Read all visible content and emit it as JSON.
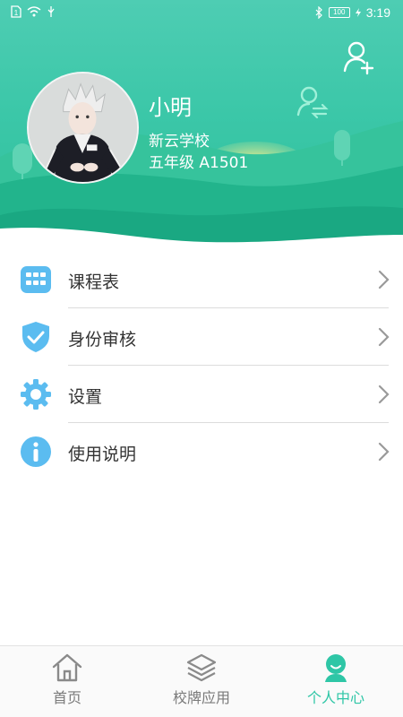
{
  "status_bar": {
    "time": "3:19",
    "battery": "100"
  },
  "profile": {
    "name": "小明",
    "school": "新云学校",
    "class": "五年级 A1501"
  },
  "menu": {
    "items": [
      {
        "label": "课程表",
        "icon": "timetable-grid-icon"
      },
      {
        "label": "身份审核",
        "icon": "shield-check-icon"
      },
      {
        "label": "设置",
        "icon": "gear-icon"
      },
      {
        "label": "使用说明",
        "icon": "info-icon"
      }
    ]
  },
  "bottom_nav": {
    "items": [
      {
        "label": "首页",
        "icon": "home-icon",
        "active": false
      },
      {
        "label": "校牌应用",
        "icon": "layers-icon",
        "active": false
      },
      {
        "label": "个人中心",
        "icon": "person-icon",
        "active": true
      }
    ]
  },
  "colors": {
    "header_teal": "#3bc7a8",
    "icon_blue": "#5bbcf0",
    "active_teal": "#2ec6a6",
    "text_dark": "#333333",
    "text_gray": "#7a7a7a"
  }
}
